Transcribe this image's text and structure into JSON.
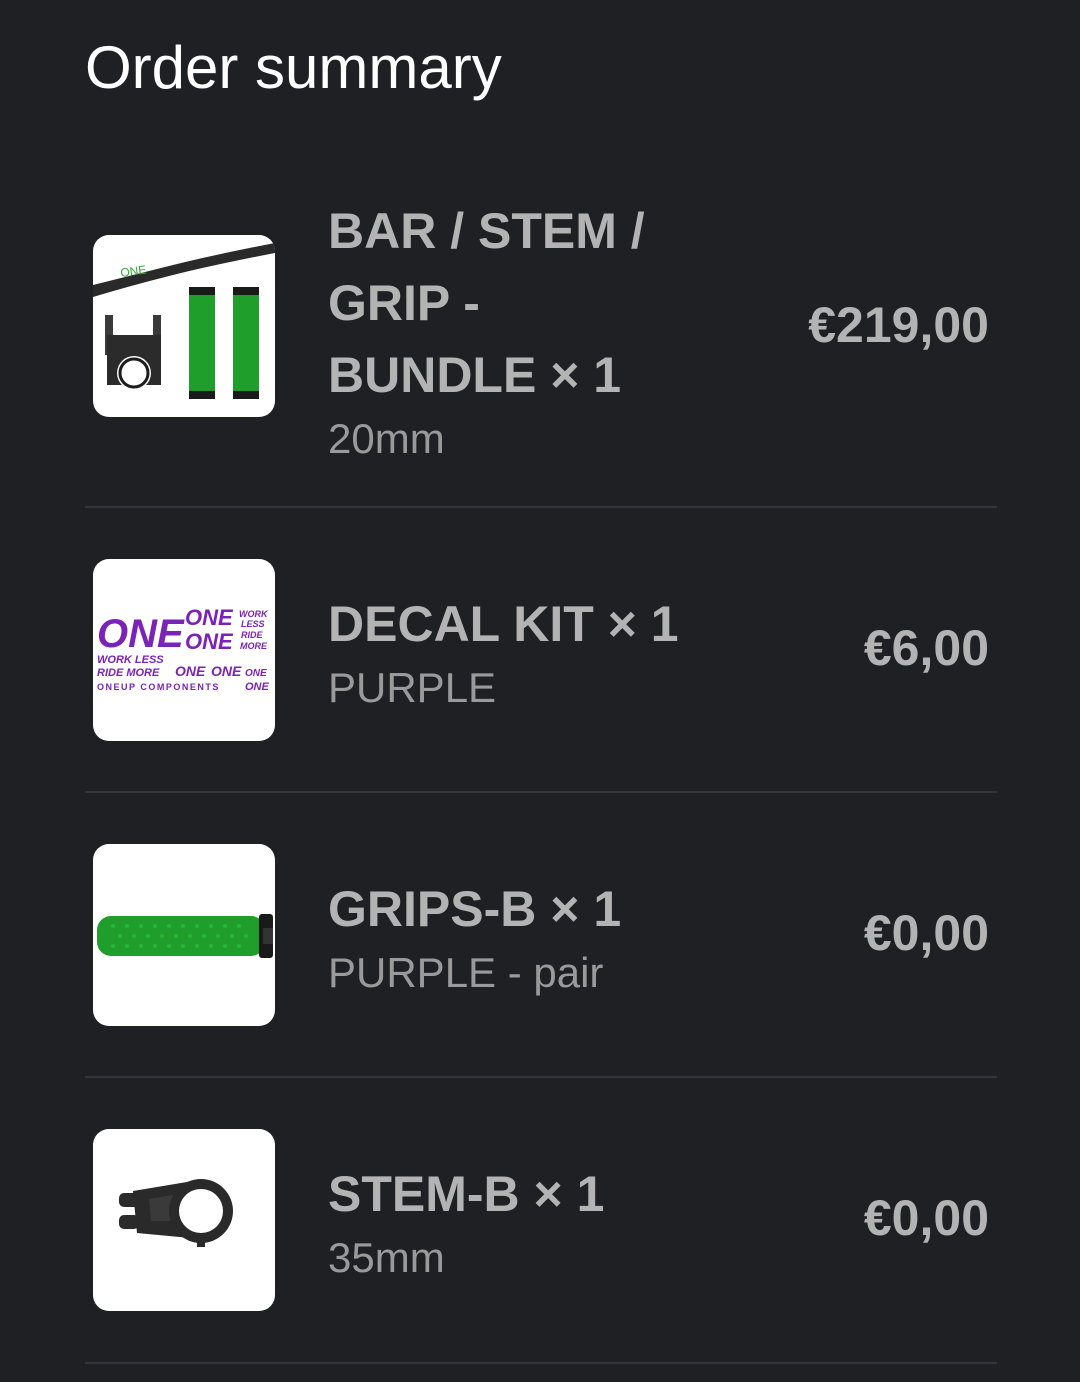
{
  "header": {
    "title": "Order summary"
  },
  "items": [
    {
      "name": "BAR / STEM / GRIP - BUNDLE × 1",
      "variant": "20mm",
      "price": "€219,00",
      "image": "bar-stem-grip-bundle-image"
    },
    {
      "name": "DECAL KIT × 1",
      "variant": "PURPLE",
      "price": "€6,00",
      "image": "decal-kit-image",
      "image_text": {
        "big": "ONE",
        "one1": "ONE",
        "one2": "ONE",
        "work1": "WORK",
        "less1": "LESS",
        "ride1": "RIDE",
        "more1": "MORE",
        "wl": "WORK LESS",
        "rm": "RIDE MORE",
        "one3": "ONE",
        "one4": "ONE",
        "one5": "ONE",
        "footer": "ONEUP COMPONENTS",
        "one6": "ONE"
      }
    },
    {
      "name": "GRIPS-B × 1",
      "variant": "PURPLE - pair",
      "price": "€0,00",
      "image": "grips-image"
    },
    {
      "name": "STEM-B × 1",
      "variant": "35mm",
      "price": "€0,00",
      "image": "stem-image"
    }
  ],
  "colors": {
    "background": "#1f2024",
    "text_primary": "#b3b3b3",
    "text_secondary": "#9a9a9a",
    "divider": "#34353a",
    "grip_green": "#1f9e2c",
    "decal_purple": "#7b22b8"
  }
}
